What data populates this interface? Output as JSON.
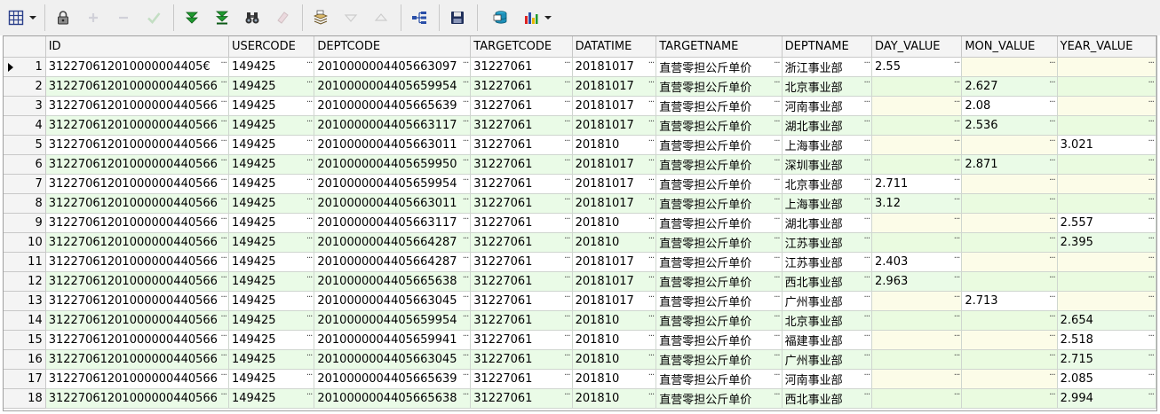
{
  "toolbar": {
    "buttons": [
      {
        "name": "grid-layout-icon",
        "enabled": true
      },
      {
        "name": "lock-icon",
        "enabled": true
      },
      {
        "name": "insert-record-icon",
        "enabled": false
      },
      {
        "name": "delete-record-icon",
        "enabled": false
      },
      {
        "name": "post-edit-icon",
        "enabled": false
      },
      {
        "name": "next-page-icon",
        "enabled": true
      },
      {
        "name": "last-page-icon",
        "enabled": true
      },
      {
        "name": "find-binoculars-icon",
        "enabled": true
      },
      {
        "name": "clear-eraser-icon",
        "enabled": false
      },
      {
        "name": "query-by-example-icon",
        "enabled": true
      },
      {
        "name": "filter-down-icon",
        "enabled": false
      },
      {
        "name": "filter-up-icon",
        "enabled": false
      },
      {
        "name": "explain-tree-icon",
        "enabled": true
      },
      {
        "name": "save-disk-icon",
        "enabled": true
      },
      {
        "name": "export-database-icon",
        "enabled": true
      },
      {
        "name": "chart-icon",
        "enabled": true
      }
    ]
  },
  "grid": {
    "columns": [
      "ID",
      "USERCODE",
      "DEPTCODE",
      "TARGETCODE",
      "DATATIME",
      "TARGETNAME",
      "DEPTNAME",
      "DAY_VALUE",
      "MON_VALUE",
      "YEAR_VALUE"
    ],
    "current_row": 1,
    "rows": [
      [
        "312270612010000004405€",
        "149425",
        "2010000004405663097",
        "31227061",
        "20181017",
        "直营零担公斤单价",
        "浙江事业部",
        "2.55",
        "",
        ""
      ],
      [
        "31227061201000000440566",
        "149425",
        "2010000004405659954",
        "31227061",
        "20181017",
        "直营零担公斤单价",
        "北京事业部",
        "",
        "2.627",
        ""
      ],
      [
        "31227061201000000440566",
        "149425",
        "2010000004405665639",
        "31227061",
        "20181017",
        "直营零担公斤单价",
        "河南事业部",
        "",
        "2.08",
        ""
      ],
      [
        "31227061201000000440566",
        "149425",
        "2010000004405663117",
        "31227061",
        "20181017",
        "直营零担公斤单价",
        "湖北事业部",
        "",
        "2.536",
        ""
      ],
      [
        "31227061201000000440566",
        "149425",
        "2010000004405663011",
        "31227061",
        "201810",
        "直营零担公斤单价",
        "上海事业部",
        "",
        "",
        "3.021"
      ],
      [
        "31227061201000000440566",
        "149425",
        "2010000004405659950",
        "31227061",
        "20181017",
        "直营零担公斤单价",
        "深圳事业部",
        "",
        "2.871",
        ""
      ],
      [
        "31227061201000000440566",
        "149425",
        "2010000004405659954",
        "31227061",
        "20181017",
        "直营零担公斤单价",
        "北京事业部",
        "2.711",
        "",
        ""
      ],
      [
        "31227061201000000440566",
        "149425",
        "2010000004405663011",
        "31227061",
        "20181017",
        "直营零担公斤单价",
        "上海事业部",
        "3.12",
        "",
        ""
      ],
      [
        "31227061201000000440566",
        "149425",
        "2010000004405663117",
        "31227061",
        "201810",
        "直营零担公斤单价",
        "湖北事业部",
        "",
        "",
        "2.557"
      ],
      [
        "31227061201000000440566",
        "149425",
        "2010000004405664287",
        "31227061",
        "201810",
        "直营零担公斤单价",
        "江苏事业部",
        "",
        "",
        "2.395"
      ],
      [
        "31227061201000000440566",
        "149425",
        "2010000004405664287",
        "31227061",
        "20181017",
        "直营零担公斤单价",
        "江苏事业部",
        "2.403",
        "",
        ""
      ],
      [
        "31227061201000000440566",
        "149425",
        "2010000004405665638",
        "31227061",
        "20181017",
        "直营零担公斤单价",
        "西北事业部",
        "2.963",
        "",
        ""
      ],
      [
        "31227061201000000440566",
        "149425",
        "2010000004405663045",
        "31227061",
        "20181017",
        "直营零担公斤单价",
        "广州事业部",
        "",
        "2.713",
        ""
      ],
      [
        "31227061201000000440566",
        "149425",
        "2010000004405659954",
        "31227061",
        "201810",
        "直营零担公斤单价",
        "北京事业部",
        "",
        "",
        "2.654"
      ],
      [
        "31227061201000000440566",
        "149425",
        "2010000004405659941",
        "31227061",
        "201810",
        "直营零担公斤单价",
        "福建事业部",
        "",
        "",
        "2.518"
      ],
      [
        "31227061201000000440566",
        "149425",
        "2010000004405663045",
        "31227061",
        "201810",
        "直营零担公斤单价",
        "广州事业部",
        "",
        "",
        "2.715"
      ],
      [
        "31227061201000000440566",
        "149425",
        "2010000004405665639",
        "31227061",
        "201810",
        "直营零担公斤单价",
        "河南事业部",
        "",
        "",
        "2.085"
      ],
      [
        "31227061201000000440566",
        "149425",
        "2010000004405665638",
        "31227061",
        "201810",
        "直营零担公斤单价",
        "西北事业部",
        "",
        "",
        "2.994"
      ]
    ]
  }
}
